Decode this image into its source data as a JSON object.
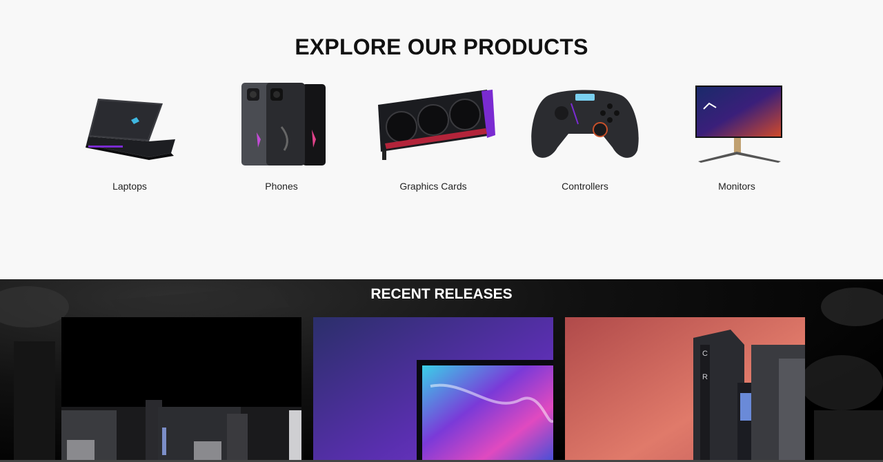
{
  "explore": {
    "title": "EXPLORE OUR PRODUCTS",
    "categories": [
      {
        "label": "Laptops",
        "icon": "laptop-image"
      },
      {
        "label": "Phones",
        "icon": "phone-image"
      },
      {
        "label": "Graphics Cards",
        "icon": "graphics-card-image"
      },
      {
        "label": "Controllers",
        "icon": "controller-image"
      },
      {
        "label": "Monitors",
        "icon": "monitor-image"
      }
    ]
  },
  "recent": {
    "title": "RECENT RELEASES",
    "cards": [
      {
        "icon": "motherboard-image"
      },
      {
        "icon": "monitor-release-image"
      },
      {
        "icon": "crosshair-motherboard-image"
      }
    ]
  }
}
